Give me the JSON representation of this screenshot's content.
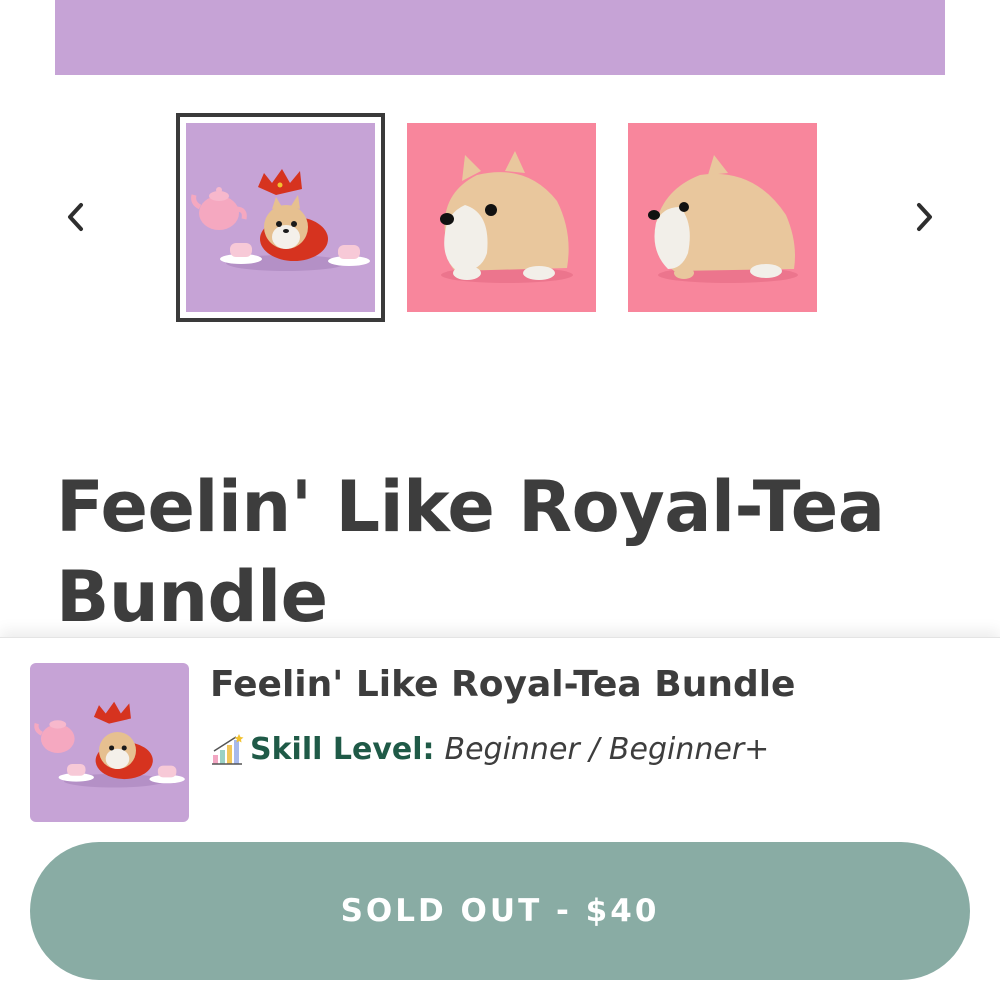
{
  "colors": {
    "hero_lavender": "#c6a3d6",
    "thumb_pink": "#f8869c",
    "title_text": "#3d3d3d",
    "skill_label": "#1f5a47",
    "button_bg": "#89aca4",
    "button_text": "#ffffff",
    "selected_border": "#3a3a3a"
  },
  "gallery": {
    "prev_icon": "chevron-left-icon",
    "next_icon": "chevron-right-icon",
    "thumbnails": [
      {
        "image": "royal-tea-bundle-thumbnail",
        "selected": true
      },
      {
        "image": "shiba-front-thumbnail",
        "selected": false
      },
      {
        "image": "shiba-side-thumbnail",
        "selected": false
      }
    ]
  },
  "product": {
    "title": "Feelin' Like Royal-Tea Bundle"
  },
  "sticky_bar": {
    "title": "Feelin' Like Royal-Tea Bundle",
    "skill_icon": "bar-chart-sparkle-icon",
    "skill_label": "Skill Level:",
    "skill_value": "Beginner / Beginner+",
    "button_label": "SOLD OUT - $40"
  }
}
